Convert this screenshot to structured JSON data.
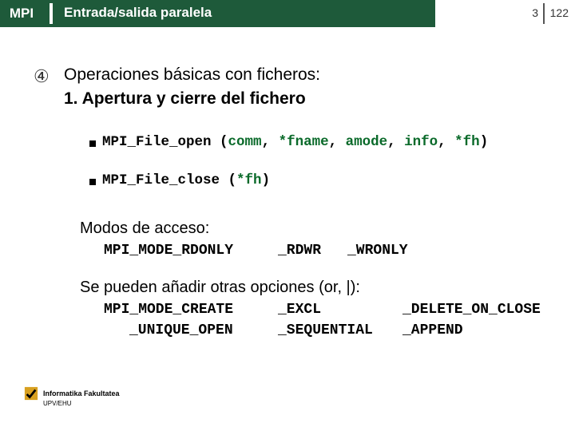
{
  "header": {
    "mpi": "MPI",
    "title": "Entrada/salida paralela",
    "page_current": "3",
    "page_total": "122"
  },
  "body": {
    "bullet_marker": "④",
    "heading_line1": "Operaciones básicas con ficheros:",
    "heading_line2": "1. Apertura y cierre del fichero",
    "code_open_fn": "MPI_File_open ",
    "code_open_lp": "(",
    "code_open_p1": "comm",
    "code_open_c1": ", ",
    "code_open_p2": "*fname",
    "code_open_c2": ", ",
    "code_open_p3": "amode",
    "code_open_c3": ", ",
    "code_open_p4": "info",
    "code_open_c4": ", ",
    "code_open_p5": "*fh",
    "code_open_rp": ")",
    "code_close_fn": "MPI_File_close ",
    "code_close_lp": "(",
    "code_close_p1": "*fh",
    "code_close_rp": ")",
    "access_label": "Modos de acceso:",
    "mode_rdonly": "MPI_MODE_RDONLY",
    "mode_rdwr": "_RDWR",
    "mode_wronly": "_WRONLY",
    "options_label": "Se pueden añadir otras opciones (or, |):",
    "mode_create": "MPI_MODE_CREATE",
    "mode_excl": "_EXCL",
    "mode_delete": "_DELETE_ON_CLOSE",
    "mode_unique": "_UNIQUE_OPEN",
    "mode_seq": "_SEQUENTIAL",
    "mode_append": "_APPEND"
  },
  "footer": {
    "line1": "Informatika Fakultatea",
    "line2": "UPV/EHU"
  }
}
